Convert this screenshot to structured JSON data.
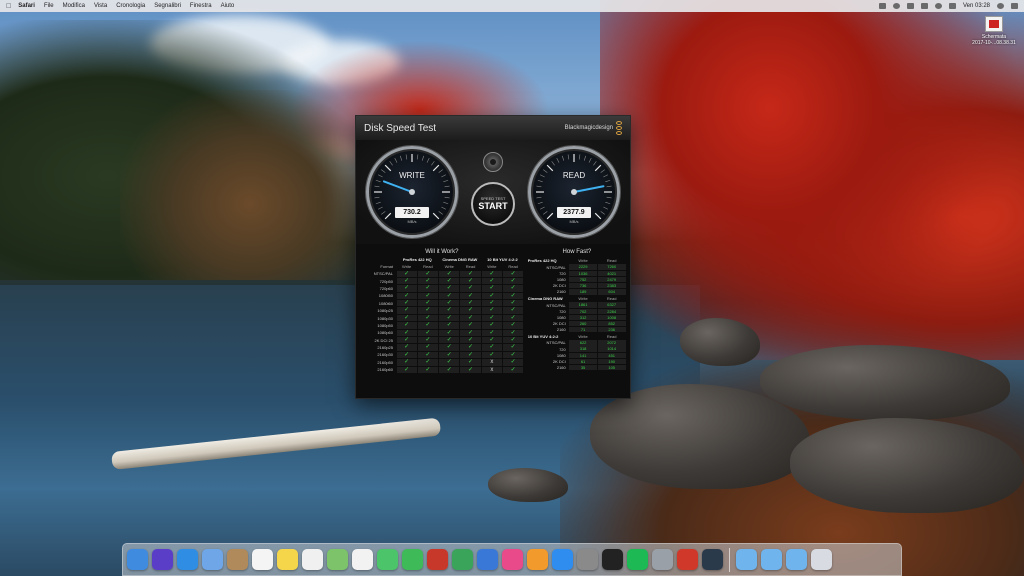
{
  "menubar": {
    "apple": "",
    "items": [
      "Safari",
      "File",
      "Modifica",
      "Vista",
      "Cronologia",
      "Segnalibri",
      "Finestra",
      "Aiuto"
    ],
    "clock": "Ven 03:28"
  },
  "desktop_file": {
    "label_line1": "Schermata",
    "label_line2": "2017-10-...08.38.31"
  },
  "app": {
    "title": "Disk Speed Test",
    "brand": "Blackmagicdesign"
  },
  "gauges": {
    "write": {
      "label": "WRITE",
      "value": "730.2",
      "unit": "MB/s",
      "needle_mbps": 730.2
    },
    "read": {
      "label": "READ",
      "value": "2377.9",
      "unit": "MB/s",
      "needle_mbps": 2377.9
    },
    "scale_max_mbps": 3000
  },
  "start_button": {
    "small": "SPEED TEST",
    "big": "START"
  },
  "will_it_work": {
    "heading": "Will it Work?",
    "format_header": "Format",
    "groups": [
      "ProRes 422 HQ",
      "Cinema DNG RAW",
      "10 Bit YUV 4:2:2"
    ],
    "subcols": [
      "Write",
      "Read"
    ],
    "rows": [
      {
        "format": "NTSC/PAL",
        "cells": [
          "✓",
          "✓",
          "✓",
          "✓",
          "✓",
          "✓"
        ]
      },
      {
        "format": "720p50",
        "cells": [
          "✓",
          "✓",
          "✓",
          "✓",
          "✓",
          "✓"
        ]
      },
      {
        "format": "720p60",
        "cells": [
          "✓",
          "✓",
          "✓",
          "✓",
          "✓",
          "✓"
        ]
      },
      {
        "format": "1080i50",
        "cells": [
          "✓",
          "✓",
          "✓",
          "✓",
          "✓",
          "✓"
        ]
      },
      {
        "format": "1080i60",
        "cells": [
          "✓",
          "✓",
          "✓",
          "✓",
          "✓",
          "✓"
        ]
      },
      {
        "format": "1080p25",
        "cells": [
          "✓",
          "✓",
          "✓",
          "✓",
          "✓",
          "✓"
        ]
      },
      {
        "format": "1080p30",
        "cells": [
          "✓",
          "✓",
          "✓",
          "✓",
          "✓",
          "✓"
        ]
      },
      {
        "format": "1080p50",
        "cells": [
          "✓",
          "✓",
          "✓",
          "✓",
          "✓",
          "✓"
        ]
      },
      {
        "format": "1080p60",
        "cells": [
          "✓",
          "✓",
          "✓",
          "✓",
          "✓",
          "✓"
        ]
      },
      {
        "format": "2K DCI 25",
        "cells": [
          "✓",
          "✓",
          "✓",
          "✓",
          "✓",
          "✓"
        ]
      },
      {
        "format": "2160p25",
        "cells": [
          "✓",
          "✓",
          "✓",
          "✓",
          "✓",
          "✓"
        ]
      },
      {
        "format": "2160p30",
        "cells": [
          "✓",
          "✓",
          "✓",
          "✓",
          "✓",
          "✓"
        ]
      },
      {
        "format": "2160p50",
        "cells": [
          "✓",
          "✓",
          "✓",
          "✓",
          "x",
          "✓"
        ]
      },
      {
        "format": "2160p60",
        "cells": [
          "✓",
          "✓",
          "✓",
          "✓",
          "x",
          "✓"
        ]
      }
    ]
  },
  "how_fast": {
    "heading": "How Fast?",
    "subcols": [
      "Write",
      "Read"
    ],
    "sections": [
      {
        "name": "ProRes 422 HQ",
        "rows": [
          {
            "res": "NTSC/PAL",
            "write": "2229",
            "read": "7260"
          },
          {
            "res": "720",
            "write": "1036",
            "read": "4021"
          },
          {
            "res": "1080",
            "write": "752",
            "read": "2479"
          },
          {
            "res": "2K DCI",
            "write": "736",
            "read": "2383"
          },
          {
            "res": "2160",
            "write": "189",
            "read": "604"
          }
        ]
      },
      {
        "name": "Cinema DNG RAW",
        "rows": [
          {
            "res": "NTSC/PAL",
            "write": "1861",
            "read": "6327"
          },
          {
            "res": "720",
            "write": "702",
            "read": "2284"
          },
          {
            "res": "1080",
            "write": "312",
            "read": "1008"
          },
          {
            "res": "2K DCI",
            "write": "260",
            "read": "852"
          },
          {
            "res": "2160",
            "write": "71",
            "read": "236"
          }
        ]
      },
      {
        "name": "10 Bit YUV 4:2:2",
        "rows": [
          {
            "res": "NTSC/PAL",
            "write": "622",
            "read": "2072"
          },
          {
            "res": "720",
            "write": "318",
            "read": "1014"
          },
          {
            "res": "1080",
            "write": "141",
            "read": "451"
          },
          {
            "res": "2K DCI",
            "write": "61",
            "read": "190"
          },
          {
            "res": "2160",
            "write": "35",
            "read": "105"
          }
        ]
      }
    ]
  },
  "dock": {
    "apps": [
      {
        "name": "finder-icon",
        "color": "#3f8be0"
      },
      {
        "name": "siri-icon",
        "color": "#5a3ec8"
      },
      {
        "name": "safari-icon",
        "color": "#2f8de4"
      },
      {
        "name": "mail-icon",
        "color": "#6fa6e8"
      },
      {
        "name": "contacts-icon",
        "color": "#b08a5a"
      },
      {
        "name": "calendar-icon",
        "color": "#f4f4f4"
      },
      {
        "name": "notes-icon",
        "color": "#f5d64a"
      },
      {
        "name": "reminders-icon",
        "color": "#f0f0f0"
      },
      {
        "name": "maps-icon",
        "color": "#7cc36a"
      },
      {
        "name": "photos-icon",
        "color": "#f2f2f2"
      },
      {
        "name": "messages-icon",
        "color": "#4cc46a"
      },
      {
        "name": "facetime-icon",
        "color": "#3fba58"
      },
      {
        "name": "photobooth-icon",
        "color": "#c8382a"
      },
      {
        "name": "numbers-icon",
        "color": "#3aa55a"
      },
      {
        "name": "keynote-icon",
        "color": "#3a78d8"
      },
      {
        "name": "itunes-icon",
        "color": "#e84a8a"
      },
      {
        "name": "ibooks-icon",
        "color": "#f29a2c"
      },
      {
        "name": "appstore-icon",
        "color": "#2f8df0"
      },
      {
        "name": "system-preferences-icon",
        "color": "#8a8a8a"
      },
      {
        "name": "disk-speed-test-icon",
        "color": "#222222"
      },
      {
        "name": "spotify-icon",
        "color": "#1db954"
      },
      {
        "name": "rocket-icon",
        "color": "#9aa0a8"
      },
      {
        "name": "flashcard-icon",
        "color": "#d0382a"
      },
      {
        "name": "quicktime-icon",
        "color": "#2a3a4a"
      },
      {
        "name": "downloads-folder-icon",
        "color": "#6fb4ec"
      },
      {
        "name": "documents-folder-icon",
        "color": "#6fb4ec"
      },
      {
        "name": "applications-folder-icon",
        "color": "#6fb4ec"
      },
      {
        "name": "trash-icon",
        "color": "#d8dce2"
      }
    ]
  }
}
